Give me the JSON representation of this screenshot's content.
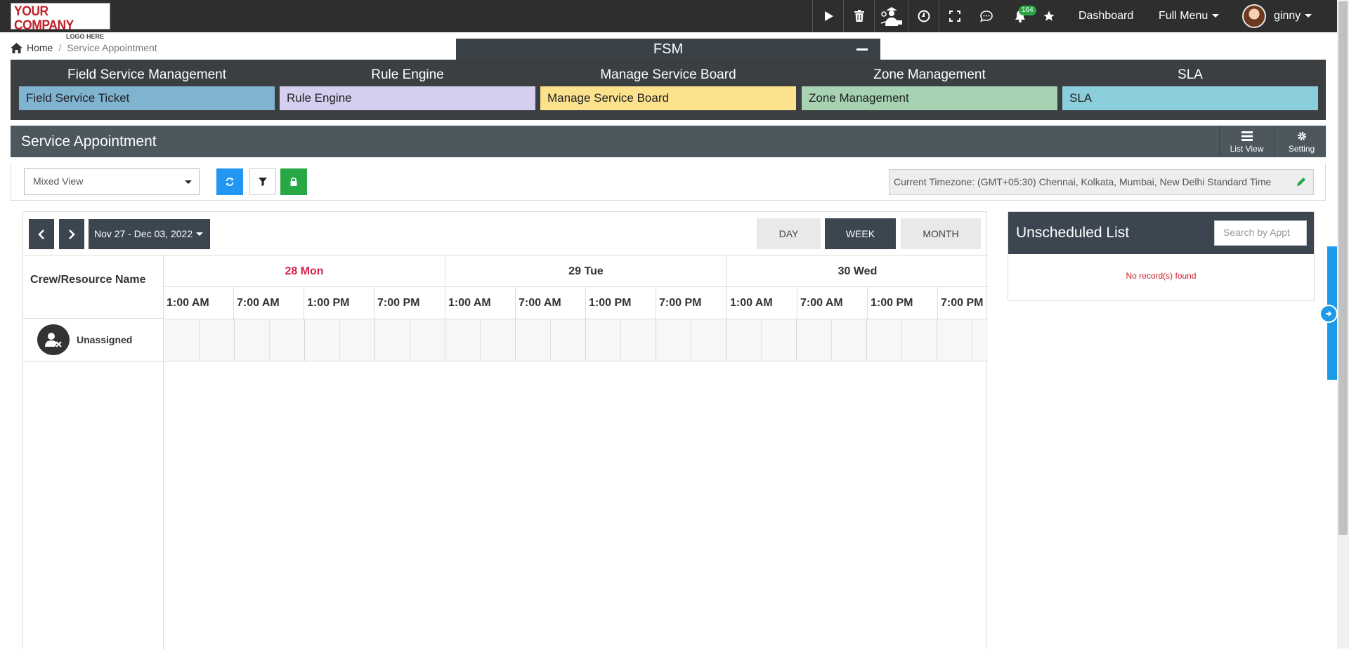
{
  "logo": {
    "line1": "YOUR COMPANY",
    "line2": "LOGO HERE"
  },
  "topbar": {
    "notification_count": "164",
    "dashboard_label": "Dashboard",
    "full_menu_label": "Full Menu",
    "user_name": "ginny",
    "icons": [
      "play-icon",
      "trash-icon",
      "technician-icon",
      "clock-icon",
      "fullscreen-icon",
      "chat-icon",
      "bell-icon",
      "star-icon"
    ]
  },
  "breadcrumb": {
    "home": "Home",
    "current": "Service Appointment"
  },
  "fsm": {
    "title": "FSM",
    "columns": [
      {
        "heading": "Field Service Management",
        "button": "Field Service Ticket",
        "color": "#7fb3cf"
      },
      {
        "heading": "Rule Engine",
        "button": "Rule Engine",
        "color": "#d4cfee"
      },
      {
        "heading": "Manage Service Board",
        "button": "Manage Service Board",
        "color": "#fde28e"
      },
      {
        "heading": "Zone Management",
        "button": "Zone Management",
        "color": "#a8d3b3"
      },
      {
        "heading": "SLA",
        "button": "SLA",
        "color": "#8ccfdc"
      }
    ]
  },
  "service_appointment": {
    "title": "Service Appointment",
    "list_view_label": "List View",
    "setting_label": "Setting"
  },
  "toolbar": {
    "view_select_value": "Mixed View",
    "timezone_text": "Current Timezone: (GMT+05:30) Chennai, Kolkata, Mumbai, New Delhi Standard Time"
  },
  "calendar": {
    "date_range": "Nov 27 - Dec 03, 2022",
    "views": [
      "DAY",
      "WEEK",
      "MONTH"
    ],
    "active_view": "WEEK",
    "crew_header": "Crew/Resource Name",
    "days": [
      {
        "label": "28 Mon",
        "today": true,
        "slots": [
          "1:00 AM",
          "7:00 AM",
          "1:00 PM",
          "7:00 PM"
        ]
      },
      {
        "label": "29 Tue",
        "today": false,
        "slots": [
          "1:00 AM",
          "7:00 AM",
          "1:00 PM",
          "7:00 PM"
        ]
      },
      {
        "label": "30 Wed",
        "today": false,
        "slots": [
          "1:00 AM",
          "7:00 AM",
          "1:00 PM",
          "7:00 PM"
        ]
      }
    ],
    "resources": [
      {
        "name": "Unassigned"
      }
    ]
  },
  "unscheduled": {
    "title": "Unscheduled List",
    "search_placeholder": "Search by Appt",
    "empty_text": "No record(s) found"
  }
}
